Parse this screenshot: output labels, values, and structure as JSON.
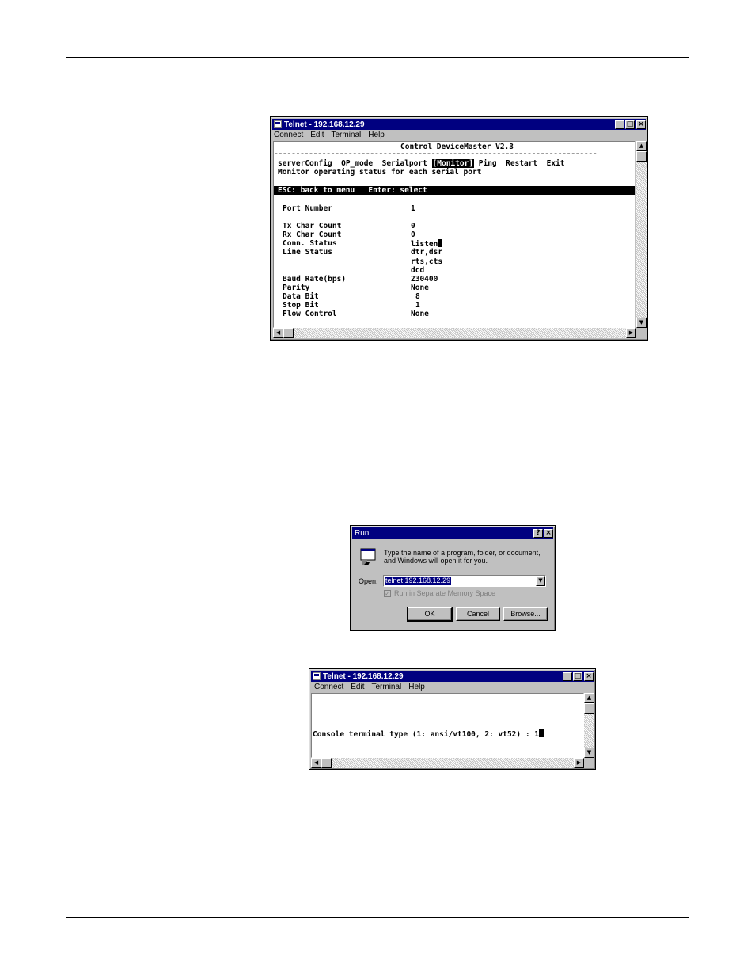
{
  "monitor_window": {
    "title": "Telnet - 192.168.12.29",
    "menu": [
      "Connect",
      "Edit",
      "Terminal",
      "Help"
    ],
    "header": "Control DeviceMaster V2.3",
    "separator": "--------------------------------------------------------------------------",
    "nav": {
      "serverconfig": "serverConfig",
      "op_mode": "OP_mode",
      "serialport": "Serialport",
      "monitor": "[Monitor]",
      "ping": "Ping",
      "restart": "Restart",
      "exit": "Exit"
    },
    "description": "Monitor operating status for each serial port",
    "status_bar": "ESC: back to menu   Enter: select",
    "fields": {
      "port_number": {
        "label": "Port Number",
        "value": "1"
      },
      "tx_char_count": {
        "label": "Tx Char Count",
        "value": "0"
      },
      "rx_char_count": {
        "label": "Rx Char Count",
        "value": "0"
      },
      "conn_status": {
        "label": "Conn. Status",
        "value": "listen"
      },
      "line_status": {
        "label": "Line Status",
        "value1": "dtr,dsr",
        "value2": "rts,cts",
        "value3": "dcd"
      },
      "baud_rate": {
        "label": "Baud Rate(bps)",
        "value": "230400"
      },
      "parity": {
        "label": "Parity",
        "value": "None"
      },
      "data_bit": {
        "label": "Data Bit",
        "value": "8"
      },
      "stop_bit": {
        "label": "Stop Bit",
        "value": "1"
      },
      "flow_control": {
        "label": "Flow Control",
        "value": "None"
      }
    }
  },
  "run_dialog": {
    "title": "Run",
    "description": "Type the name of a program, folder, or document, and Windows will open it for you.",
    "open_label": "Open:",
    "open_value": "telnet 192.168.12.29",
    "checkbox_label": "Run in Separate Memory Space",
    "ok_label": "OK",
    "cancel_label": "Cancel",
    "browse_label": "Browse..."
  },
  "console_window": {
    "title": "Telnet - 192.168.12.29",
    "menu": [
      "Connect",
      "Edit",
      "Terminal",
      "Help"
    ],
    "prompt": "Console terminal type (1: ansi/vt100, 2: vt52) : ",
    "input": "1"
  },
  "colors": {
    "titlebar": "#000080",
    "window_face": "#c0c0c0",
    "terminal_bg": "#ffffff"
  }
}
